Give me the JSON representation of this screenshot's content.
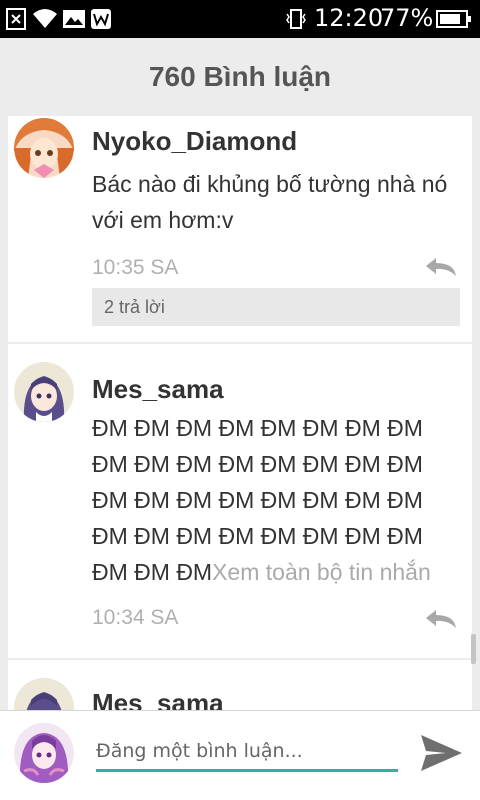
{
  "status_bar": {
    "time": "12:20",
    "battery_percent": "77%",
    "icons": [
      "close-box-icon",
      "wifi-icon",
      "image-icon",
      "w-app-icon",
      "vibrate-icon",
      "battery-icon"
    ]
  },
  "header": {
    "title": "760 Bình luận"
  },
  "comments": [
    {
      "username": "Nyoko_Diamond",
      "text": "Bác nào đi khủng bố tường nhà nó với em hơm:v",
      "time": "10:35 SA",
      "replies_label": "2 trả lời"
    },
    {
      "username": "Mes_sama",
      "text": "ĐM ĐM ĐM ĐM ĐM ĐM ĐM ĐM ĐM ĐM ĐM ĐM ĐM ĐM ĐM ĐM ĐM ĐM ĐM ĐM ĐM ĐM ĐM ĐM ĐM ĐM ĐM ĐM ĐM ĐM ĐM ĐM ĐM ĐM ĐM",
      "see_more": "Xem toàn bộ tin nhắn",
      "time": "10:34 SA"
    },
    {
      "username": "Mes_sama"
    }
  ],
  "composer": {
    "placeholder": "Đăng một bình luận..."
  },
  "colors": {
    "accent": "#26b5a6",
    "background": "#ececec",
    "muted": "#b0b0b0"
  }
}
